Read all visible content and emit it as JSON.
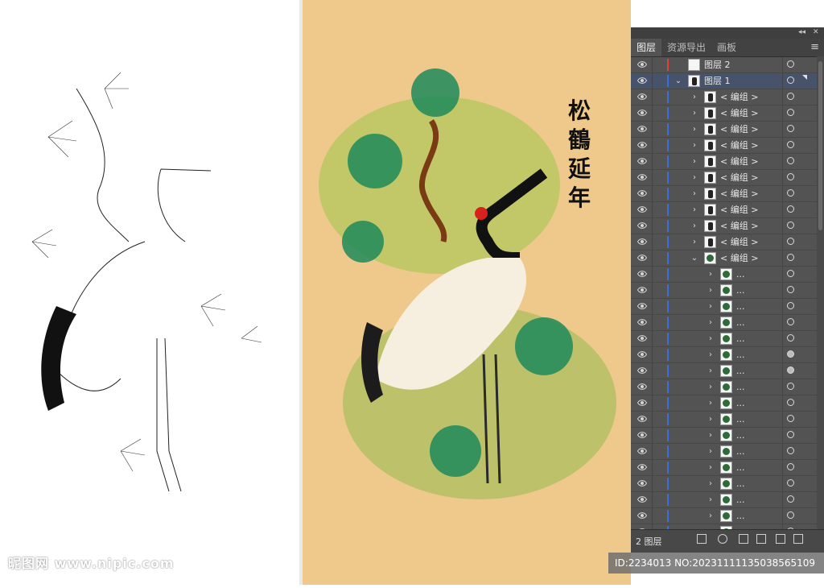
{
  "artwork": {
    "calligraphy": [
      "松",
      "鶴",
      "延",
      "年"
    ]
  },
  "panel": {
    "tabs": [
      {
        "label": "图层",
        "active": true
      },
      {
        "label": "资源导出",
        "active": false
      },
      {
        "label": "画板",
        "active": false
      }
    ],
    "top_controls": [
      "◂◂",
      "✕"
    ],
    "menu_icon": "hamburger-menu-icon",
    "layers": [
      {
        "label": "图层 2",
        "level": 0,
        "expanded": null,
        "color": "#e0423a",
        "selected": false,
        "thumb": "blank"
      },
      {
        "label": "图层 1",
        "level": 0,
        "expanded": true,
        "color": "#3b6ed8",
        "selected": true,
        "thumb": "art"
      },
      {
        "label": "< 编组 >",
        "level": 1,
        "expanded": false,
        "color": "#3b6ed8",
        "thumb": "dark"
      },
      {
        "label": "< 编组 >",
        "level": 1,
        "expanded": false,
        "color": "#3b6ed8",
        "thumb": "dark"
      },
      {
        "label": "< 编组 >",
        "level": 1,
        "expanded": false,
        "color": "#3b6ed8",
        "thumb": "dark"
      },
      {
        "label": "< 编组 >",
        "level": 1,
        "expanded": false,
        "color": "#3b6ed8",
        "thumb": "dark"
      },
      {
        "label": "< 编组 >",
        "level": 1,
        "expanded": false,
        "color": "#3b6ed8",
        "thumb": "dark"
      },
      {
        "label": "< 编组 >",
        "level": 1,
        "expanded": false,
        "color": "#3b6ed8",
        "thumb": "dark"
      },
      {
        "label": "< 编组 >",
        "level": 1,
        "expanded": false,
        "color": "#3b6ed8",
        "thumb": "dark"
      },
      {
        "label": "< 编组 >",
        "level": 1,
        "expanded": false,
        "color": "#3b6ed8",
        "thumb": "dark"
      },
      {
        "label": "< 编组 >",
        "level": 1,
        "expanded": false,
        "color": "#3b6ed8",
        "thumb": "dark"
      },
      {
        "label": "< 编组 >",
        "level": 1,
        "expanded": false,
        "color": "#3b6ed8",
        "thumb": "dark"
      },
      {
        "label": "< 编组 >",
        "level": 1,
        "expanded": true,
        "color": "#3b6ed8",
        "thumb": "green"
      },
      {
        "label": "...",
        "level": 2,
        "expanded": false,
        "color": "#3b6ed8",
        "thumb": "green"
      },
      {
        "label": "...",
        "level": 2,
        "expanded": false,
        "color": "#3b6ed8",
        "thumb": "green"
      },
      {
        "label": "...",
        "level": 2,
        "expanded": false,
        "color": "#3b6ed8",
        "thumb": "green"
      },
      {
        "label": "...",
        "level": 2,
        "expanded": false,
        "color": "#3b6ed8",
        "thumb": "green"
      },
      {
        "label": "...",
        "level": 2,
        "expanded": false,
        "color": "#3b6ed8",
        "thumb": "green"
      },
      {
        "label": "...",
        "level": 2,
        "expanded": false,
        "color": "#3b6ed8",
        "thumb": "green",
        "target_filled": true
      },
      {
        "label": "...",
        "level": 2,
        "expanded": false,
        "color": "#3b6ed8",
        "thumb": "green",
        "target_filled": true
      },
      {
        "label": "...",
        "level": 2,
        "expanded": false,
        "color": "#3b6ed8",
        "thumb": "green"
      },
      {
        "label": "...",
        "level": 2,
        "expanded": false,
        "color": "#3b6ed8",
        "thumb": "green"
      },
      {
        "label": "...",
        "level": 2,
        "expanded": false,
        "color": "#3b6ed8",
        "thumb": "green"
      },
      {
        "label": "...",
        "level": 2,
        "expanded": false,
        "color": "#3b6ed8",
        "thumb": "green"
      },
      {
        "label": "...",
        "level": 2,
        "expanded": false,
        "color": "#3b6ed8",
        "thumb": "green"
      },
      {
        "label": "...",
        "level": 2,
        "expanded": false,
        "color": "#3b6ed8",
        "thumb": "green"
      },
      {
        "label": "...",
        "level": 2,
        "expanded": false,
        "color": "#3b6ed8",
        "thumb": "green"
      },
      {
        "label": "...",
        "level": 2,
        "expanded": false,
        "color": "#3b6ed8",
        "thumb": "green"
      },
      {
        "label": "...",
        "level": 2,
        "expanded": false,
        "color": "#3b6ed8",
        "thumb": "green"
      },
      {
        "label": "...",
        "level": 2,
        "expanded": false,
        "color": "#3b6ed8",
        "thumb": "green"
      },
      {
        "label": "...",
        "level": 2,
        "expanded": false,
        "color": "#3b6ed8",
        "thumb": "green"
      },
      {
        "label": "...",
        "level": 2,
        "expanded": false,
        "color": "#3b6ed8",
        "thumb": "green"
      }
    ],
    "footer": {
      "count_label": "2 图层",
      "icons": [
        "export-icon",
        "search-icon",
        "clip-mask-icon",
        "new-sublayer-icon",
        "new-layer-icon",
        "trash-icon"
      ]
    }
  },
  "watermarks": {
    "left": "昵图网 www.nipic.com",
    "right": "ID:2234013 NO:20231111135038565109"
  }
}
